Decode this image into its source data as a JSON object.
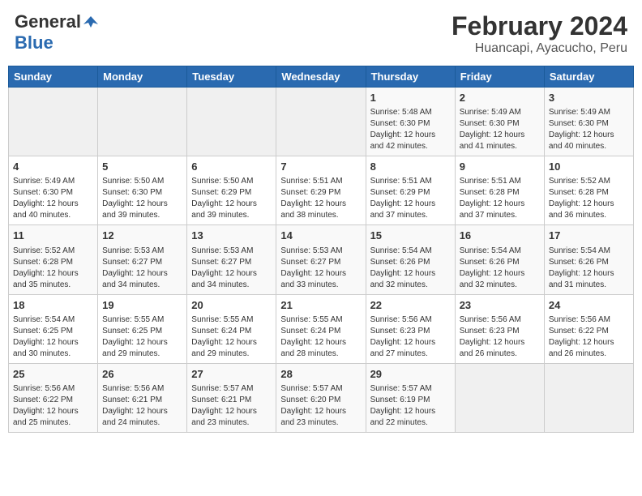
{
  "header": {
    "logo_general": "General",
    "logo_blue": "Blue",
    "title": "February 2024",
    "subtitle": "Huancapi, Ayacucho, Peru"
  },
  "weekdays": [
    "Sunday",
    "Monday",
    "Tuesday",
    "Wednesday",
    "Thursday",
    "Friday",
    "Saturday"
  ],
  "weeks": [
    [
      {
        "day": "",
        "info": ""
      },
      {
        "day": "",
        "info": ""
      },
      {
        "day": "",
        "info": ""
      },
      {
        "day": "",
        "info": ""
      },
      {
        "day": "1",
        "info": "Sunrise: 5:48 AM\nSunset: 6:30 PM\nDaylight: 12 hours\nand 42 minutes."
      },
      {
        "day": "2",
        "info": "Sunrise: 5:49 AM\nSunset: 6:30 PM\nDaylight: 12 hours\nand 41 minutes."
      },
      {
        "day": "3",
        "info": "Sunrise: 5:49 AM\nSunset: 6:30 PM\nDaylight: 12 hours\nand 40 minutes."
      }
    ],
    [
      {
        "day": "4",
        "info": "Sunrise: 5:49 AM\nSunset: 6:30 PM\nDaylight: 12 hours\nand 40 minutes."
      },
      {
        "day": "5",
        "info": "Sunrise: 5:50 AM\nSunset: 6:30 PM\nDaylight: 12 hours\nand 39 minutes."
      },
      {
        "day": "6",
        "info": "Sunrise: 5:50 AM\nSunset: 6:29 PM\nDaylight: 12 hours\nand 39 minutes."
      },
      {
        "day": "7",
        "info": "Sunrise: 5:51 AM\nSunset: 6:29 PM\nDaylight: 12 hours\nand 38 minutes."
      },
      {
        "day": "8",
        "info": "Sunrise: 5:51 AM\nSunset: 6:29 PM\nDaylight: 12 hours\nand 37 minutes."
      },
      {
        "day": "9",
        "info": "Sunrise: 5:51 AM\nSunset: 6:28 PM\nDaylight: 12 hours\nand 37 minutes."
      },
      {
        "day": "10",
        "info": "Sunrise: 5:52 AM\nSunset: 6:28 PM\nDaylight: 12 hours\nand 36 minutes."
      }
    ],
    [
      {
        "day": "11",
        "info": "Sunrise: 5:52 AM\nSunset: 6:28 PM\nDaylight: 12 hours\nand 35 minutes."
      },
      {
        "day": "12",
        "info": "Sunrise: 5:53 AM\nSunset: 6:27 PM\nDaylight: 12 hours\nand 34 minutes."
      },
      {
        "day": "13",
        "info": "Sunrise: 5:53 AM\nSunset: 6:27 PM\nDaylight: 12 hours\nand 34 minutes."
      },
      {
        "day": "14",
        "info": "Sunrise: 5:53 AM\nSunset: 6:27 PM\nDaylight: 12 hours\nand 33 minutes."
      },
      {
        "day": "15",
        "info": "Sunrise: 5:54 AM\nSunset: 6:26 PM\nDaylight: 12 hours\nand 32 minutes."
      },
      {
        "day": "16",
        "info": "Sunrise: 5:54 AM\nSunset: 6:26 PM\nDaylight: 12 hours\nand 32 minutes."
      },
      {
        "day": "17",
        "info": "Sunrise: 5:54 AM\nSunset: 6:26 PM\nDaylight: 12 hours\nand 31 minutes."
      }
    ],
    [
      {
        "day": "18",
        "info": "Sunrise: 5:54 AM\nSunset: 6:25 PM\nDaylight: 12 hours\nand 30 minutes."
      },
      {
        "day": "19",
        "info": "Sunrise: 5:55 AM\nSunset: 6:25 PM\nDaylight: 12 hours\nand 29 minutes."
      },
      {
        "day": "20",
        "info": "Sunrise: 5:55 AM\nSunset: 6:24 PM\nDaylight: 12 hours\nand 29 minutes."
      },
      {
        "day": "21",
        "info": "Sunrise: 5:55 AM\nSunset: 6:24 PM\nDaylight: 12 hours\nand 28 minutes."
      },
      {
        "day": "22",
        "info": "Sunrise: 5:56 AM\nSunset: 6:23 PM\nDaylight: 12 hours\nand 27 minutes."
      },
      {
        "day": "23",
        "info": "Sunrise: 5:56 AM\nSunset: 6:23 PM\nDaylight: 12 hours\nand 26 minutes."
      },
      {
        "day": "24",
        "info": "Sunrise: 5:56 AM\nSunset: 6:22 PM\nDaylight: 12 hours\nand 26 minutes."
      }
    ],
    [
      {
        "day": "25",
        "info": "Sunrise: 5:56 AM\nSunset: 6:22 PM\nDaylight: 12 hours\nand 25 minutes."
      },
      {
        "day": "26",
        "info": "Sunrise: 5:56 AM\nSunset: 6:21 PM\nDaylight: 12 hours\nand 24 minutes."
      },
      {
        "day": "27",
        "info": "Sunrise: 5:57 AM\nSunset: 6:21 PM\nDaylight: 12 hours\nand 23 minutes."
      },
      {
        "day": "28",
        "info": "Sunrise: 5:57 AM\nSunset: 6:20 PM\nDaylight: 12 hours\nand 23 minutes."
      },
      {
        "day": "29",
        "info": "Sunrise: 5:57 AM\nSunset: 6:19 PM\nDaylight: 12 hours\nand 22 minutes."
      },
      {
        "day": "",
        "info": ""
      },
      {
        "day": "",
        "info": ""
      }
    ]
  ]
}
